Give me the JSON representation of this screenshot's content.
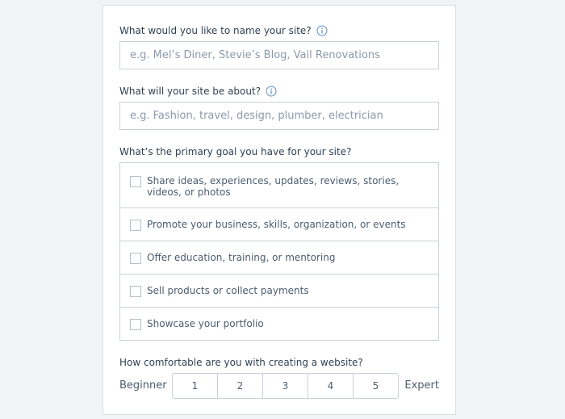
{
  "form": {
    "site_name": {
      "label": "What would you like to name your site?",
      "placeholder": "e.g. Mel’s Diner, Stevie’s Blog, Vail Renovations",
      "value": ""
    },
    "site_about": {
      "label": "What will your site be about?",
      "placeholder": "e.g. Fashion, travel, design, plumber, electrician",
      "value": ""
    },
    "primary_goal": {
      "label": "What’s the primary goal you have for your site?",
      "options": [
        {
          "label": "Share ideas, experiences, updates, reviews, stories, videos, or photos",
          "checked": false
        },
        {
          "label": "Promote your business, skills, organization, or events",
          "checked": false
        },
        {
          "label": "Offer education, training, or mentoring",
          "checked": false
        },
        {
          "label": "Sell products or collect payments",
          "checked": false
        },
        {
          "label": "Showcase your portfolio",
          "checked": false
        }
      ]
    },
    "comfort": {
      "label": "How comfortable are you with creating a website?",
      "min_label": "Beginner",
      "max_label": "Expert",
      "scale": [
        "1",
        "2",
        "3",
        "4",
        "5"
      ]
    }
  },
  "icons": {
    "info": "info-icon"
  },
  "colors": {
    "text": "#2f4152",
    "placeholder": "#8a9aab",
    "border": "#c8d1da",
    "info_icon": "#5c8fc7",
    "page_bg": "#f1f3f5"
  }
}
